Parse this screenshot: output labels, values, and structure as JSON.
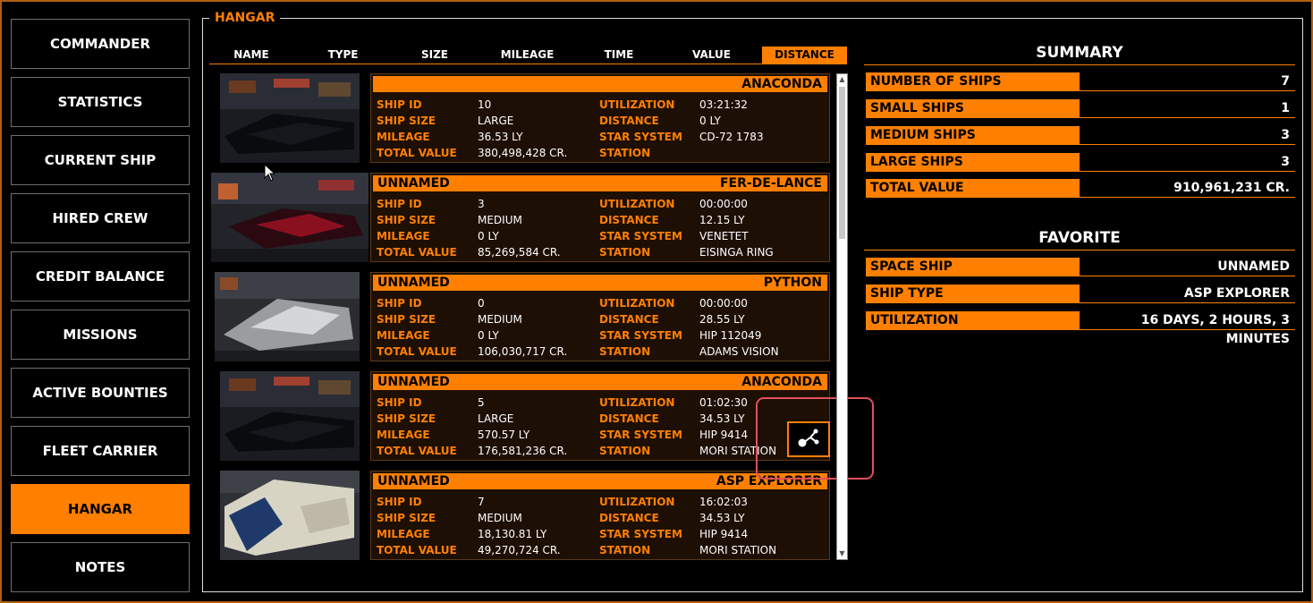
{
  "nav": [
    {
      "label": "COMMANDER",
      "active": false
    },
    {
      "label": "STATISTICS",
      "active": false
    },
    {
      "label": "CURRENT SHIP",
      "active": false
    },
    {
      "label": "HIRED CREW",
      "active": false
    },
    {
      "label": "CREDIT BALANCE",
      "active": false
    },
    {
      "label": "MISSIONS",
      "active": false
    },
    {
      "label": "ACTIVE BOUNTIES",
      "active": false
    },
    {
      "label": "FLEET CARRIER",
      "active": false
    },
    {
      "label": "HANGAR",
      "active": true
    },
    {
      "label": "NOTES",
      "active": false
    }
  ],
  "hangar": {
    "title": "HANGAR",
    "columns": [
      "NAME",
      "TYPE",
      "SIZE",
      "MILEAGE",
      "TIME",
      "VALUE",
      "DISTANCE"
    ],
    "active_column": "DISTANCE",
    "labels": {
      "ship_id": "SHIP ID",
      "ship_size": "SHIP SIZE",
      "mileage": "MILEAGE",
      "total_value": "TOTAL VALUE",
      "utilization": "UTILIZATION",
      "distance": "DISTANCE",
      "star_system": "STAR SYSTEM",
      "station": "STATION"
    },
    "ships": [
      {
        "name": "",
        "type": "ANACONDA",
        "ship_id": "10",
        "ship_size": "LARGE",
        "mileage": "36.53 LY",
        "total_value": "380,498,428 CR.",
        "utilization": "03:21:32",
        "distance": "0 LY",
        "star_system": "CD-72 1783",
        "station": ""
      },
      {
        "name": "UNNAMED",
        "type": "FER-DE-LANCE",
        "ship_id": "3",
        "ship_size": "MEDIUM",
        "mileage": "0 LY",
        "total_value": "85,269,584 CR.",
        "utilization": "00:00:00",
        "distance": "12.15 LY",
        "star_system": "VENETET",
        "station": "EISINGA RING"
      },
      {
        "name": "UNNAMED",
        "type": "PYTHON",
        "ship_id": "0",
        "ship_size": "MEDIUM",
        "mileage": "0 LY",
        "total_value": "106,030,717 CR.",
        "utilization": "00:00:00",
        "distance": "28.55 LY",
        "star_system": "HIP 112049",
        "station": "ADAMS VISION"
      },
      {
        "name": "UNNAMED",
        "type": "ANACONDA",
        "ship_id": "5",
        "ship_size": "LARGE",
        "mileage": "570.57 LY",
        "total_value": "176,581,236 CR.",
        "utilization": "01:02:30",
        "distance": "34.53 LY",
        "star_system": "HIP 9414",
        "station": "MORI STATION"
      },
      {
        "name": "UNNAMED",
        "type": "ASP EXPLORER",
        "ship_id": "7",
        "ship_size": "MEDIUM",
        "mileage": "18,130.81 LY",
        "total_value": "49,270,724 CR.",
        "utilization": "16:02:03",
        "distance": "34.53 LY",
        "star_system": "HIP 9414",
        "station": "MORI STATION"
      }
    ]
  },
  "summary": {
    "title": "SUMMARY",
    "rows": [
      {
        "label": "NUMBER OF SHIPS",
        "value": "7"
      },
      {
        "label": "SMALL SHIPS",
        "value": "1"
      },
      {
        "label": "MEDIUM SHIPS",
        "value": "3"
      },
      {
        "label": "LARGE SHIPS",
        "value": "3"
      },
      {
        "label": "TOTAL VALUE",
        "value": "910,961,231 CR."
      }
    ]
  },
  "favorite": {
    "title": "FAVORITE",
    "rows": [
      {
        "label": "SPACE SHIP",
        "value": "UNNAMED"
      },
      {
        "label": "SHIP TYPE",
        "value": "ASP EXPLORER"
      },
      {
        "label": "UTILIZATION",
        "value": "16 DAYS, 2 HOURS, 3 MINUTES"
      }
    ]
  },
  "colors": {
    "accent": "#ff8000",
    "card_bg": "#1e0f05",
    "highlight": "#e0505a"
  },
  "icons": {
    "route": "route-share-icon",
    "cursor": "mouse-pointer-icon"
  }
}
